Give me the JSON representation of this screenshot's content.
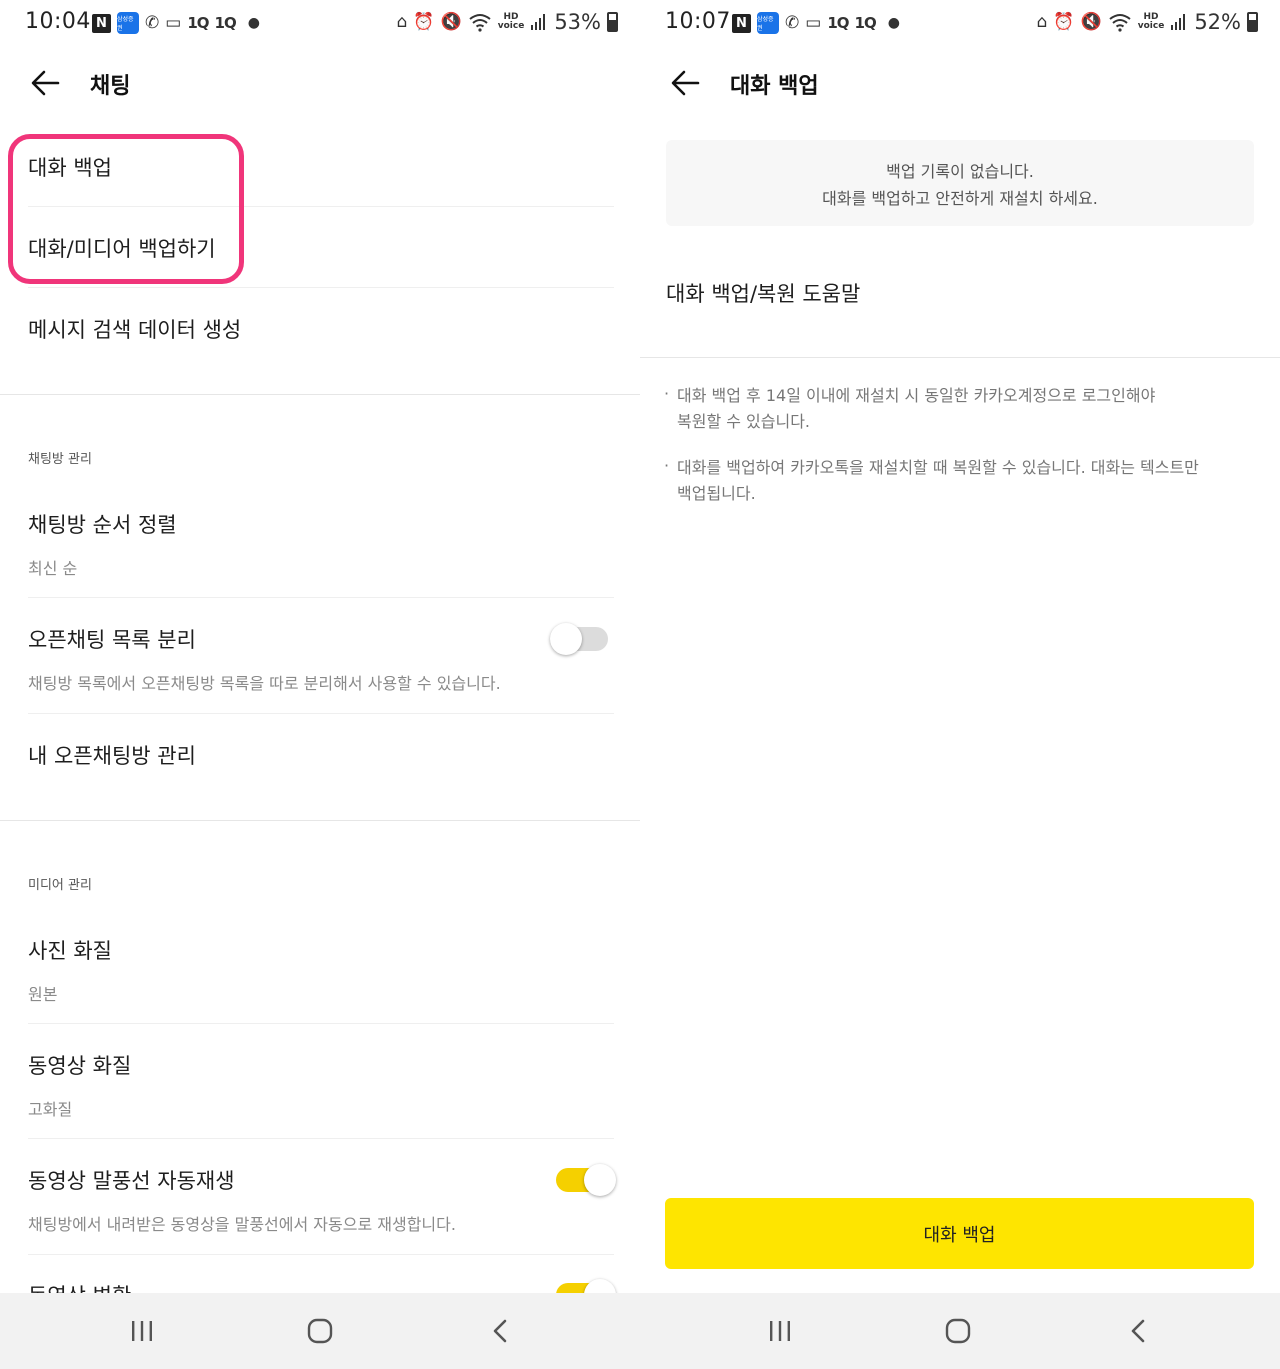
{
  "left": {
    "status": {
      "time": "10:04",
      "battery": "53%",
      "n_icon": "N",
      "samsung_icon": "삼성증권",
      "app_icon_1": "1Q",
      "app_icon_2": "1Q",
      "hd_line1": "HD",
      "hd_line2": "voice"
    },
    "header": {
      "title": "채팅"
    },
    "items": {
      "backup_chat": "대화 백업",
      "backup_media": "대화/미디어 백업하기",
      "search_data": "메시지 검색 데이터 생성"
    },
    "chat_room_section": {
      "label": "채팅방 관리",
      "sort_title": "채팅방 순서 정렬",
      "sort_value": "최신 순",
      "open_split_title": "오픈채팅 목록 분리",
      "open_split_desc": "채팅방 목록에서 오픈채팅방 목록을 따로 분리해서 사용할 수 있습니다.",
      "open_split_enabled": false,
      "my_open_chat": "내 오픈채팅방 관리"
    },
    "media_section": {
      "label": "미디어 관리",
      "photo_quality_title": "사진 화질",
      "photo_quality_value": "원본",
      "video_quality_title": "동영상 화질",
      "video_quality_value": "고화질",
      "video_autoplay_title": "동영상 말풍선 자동재생",
      "video_autoplay_desc": "채팅방에서 내려받은 동영상을 말풍선에서 자동으로 재생합니다.",
      "video_autoplay_enabled": true,
      "video_convert_title": "동영상 변환",
      "video_convert_enabled": true
    }
  },
  "right": {
    "status": {
      "time": "10:07",
      "battery": "52%",
      "n_icon": "N",
      "samsung_icon": "삼성증권",
      "app_icon_1": "1Q",
      "app_icon_2": "1Q",
      "hd_line1": "HD",
      "hd_line2": "voice"
    },
    "header": {
      "title": "대화 백업"
    },
    "notice": {
      "line1": "백업 기록이 없습니다.",
      "line2": "대화를 백업하고 안전하게 재설치 하세요."
    },
    "help_link": "대화 백업/복원 도움말",
    "bullets": [
      {
        "line1": "대화 백업 후 14일 이내에 재설치 시 동일한 카카오계정으로 로그인해야",
        "line2": "복원할 수 있습니다."
      },
      {
        "line1": "대화를 백업하여 카카오톡을 재설치할 때 복원할 수 있습니다. 대화는 텍스트만",
        "line2": "백업됩니다."
      }
    ],
    "primary_button": "대화 백업"
  },
  "colors": {
    "highlight_border": "#f0357a",
    "accent_yellow": "#fee500",
    "toggle_on": "#f5d000",
    "toggle_off": "#dcdcdc"
  }
}
